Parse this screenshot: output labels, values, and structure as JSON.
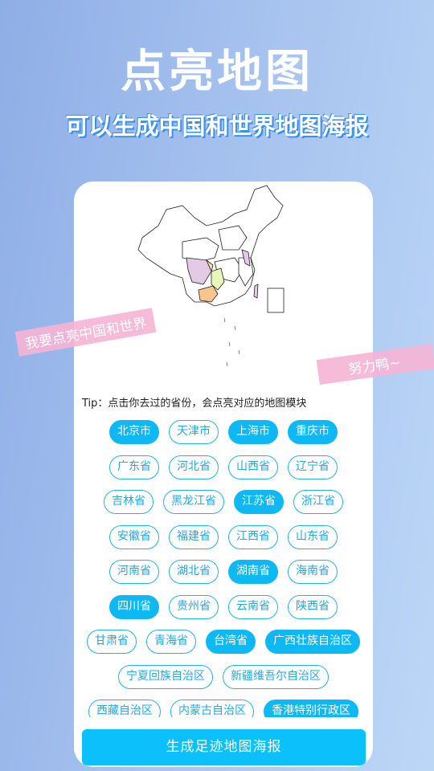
{
  "header": {
    "title": "点亮地图",
    "subtitle": "可以生成中国和世界地图海报"
  },
  "ribbons": {
    "left": "我要点亮中国和世界",
    "right": "努力鸭~"
  },
  "tip": "Tip：点击你去过的省份，会点亮对应的地图模块",
  "colors": {
    "accent": "#0db8f5",
    "ribbon": "#f6b4d6",
    "sichuan": "#e3cbe6",
    "hunan": "#e6f7b8",
    "guangxi": "#f9c58f",
    "chongqing": "#f9dcaa",
    "shanghai_jiangsu": "#ebc6f0"
  },
  "provinces": [
    [
      {
        "label": "北京市",
        "selected": true
      },
      {
        "label": "天津市",
        "selected": false
      },
      {
        "label": "上海市",
        "selected": true
      },
      {
        "label": "重庆市",
        "selected": true
      }
    ],
    [
      {
        "label": "广东省",
        "selected": false
      },
      {
        "label": "河北省",
        "selected": false
      },
      {
        "label": "山西省",
        "selected": false
      },
      {
        "label": "辽宁省",
        "selected": false
      }
    ],
    [
      {
        "label": "吉林省",
        "selected": false
      },
      {
        "label": "黑龙江省",
        "selected": false
      },
      {
        "label": "江苏省",
        "selected": true
      },
      {
        "label": "浙江省",
        "selected": false
      }
    ],
    [
      {
        "label": "安徽省",
        "selected": false
      },
      {
        "label": "福建省",
        "selected": false
      },
      {
        "label": "江西省",
        "selected": false
      },
      {
        "label": "山东省",
        "selected": false
      }
    ],
    [
      {
        "label": "河南省",
        "selected": false
      },
      {
        "label": "湖北省",
        "selected": false
      },
      {
        "label": "湖南省",
        "selected": true
      },
      {
        "label": "海南省",
        "selected": false
      }
    ],
    [
      {
        "label": "四川省",
        "selected": true
      },
      {
        "label": "贵州省",
        "selected": false
      },
      {
        "label": "云南省",
        "selected": false
      },
      {
        "label": "陕西省",
        "selected": false
      }
    ],
    [
      {
        "label": "甘肃省",
        "selected": false
      },
      {
        "label": "青海省",
        "selected": false
      },
      {
        "label": "台湾省",
        "selected": true
      },
      {
        "label": "广西壮族自治区",
        "selected": true
      }
    ],
    [
      {
        "label": "宁夏回族自治区",
        "selected": false
      },
      {
        "label": "新疆维吾尔自治区",
        "selected": false
      }
    ],
    [
      {
        "label": "西藏自治区",
        "selected": false
      },
      {
        "label": "内蒙古自治区",
        "selected": false
      },
      {
        "label": "香港特别行政区",
        "selected": true
      }
    ]
  ],
  "generate_button": "生成足迹地图海报"
}
